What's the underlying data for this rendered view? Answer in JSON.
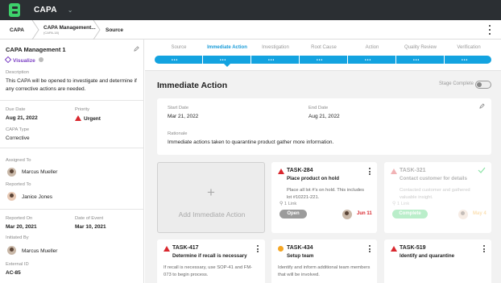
{
  "app": {
    "name": "CAPA"
  },
  "breadcrumbs": [
    {
      "label": "CAPA"
    },
    {
      "label": "CAPA Management...",
      "sub": "(CAPA-18)"
    },
    {
      "label": "Source"
    }
  ],
  "record": {
    "title": "CAPA Management 1",
    "visualize_label": "Visualize",
    "description_label": "Description",
    "description": "This CAPA will be opened to investigate and determine if any corrective actions are needed.",
    "due_date_label": "Due Date",
    "due_date": "Aug 21, 2022",
    "priority_label": "Priority",
    "priority": "Urgent",
    "capa_type_label": "CAPA Type",
    "capa_type": "Corrective",
    "assigned_to_label": "Assigned To",
    "assigned_to": "Marcus Mueller",
    "reported_to_label": "Reported To",
    "reported_to": "Janice Jones",
    "reported_on_label": "Reported On",
    "reported_on": "Mar 20, 2021",
    "date_of_event_label": "Date of Event",
    "date_of_event": "Mar 10, 2021",
    "initiated_by_label": "Initiated By",
    "initiated_by": "Marcus Mueller",
    "external_id_label": "External ID",
    "external_id": "AC-85"
  },
  "steps": [
    {
      "label": "Source",
      "active": false
    },
    {
      "label": "Immediate Action",
      "active": true
    },
    {
      "label": "Investigation",
      "active": false
    },
    {
      "label": "Root Cause",
      "active": false
    },
    {
      "label": "Action",
      "active": false
    },
    {
      "label": "Quality Review",
      "active": false
    },
    {
      "label": "Verification",
      "active": false
    }
  ],
  "section": {
    "title": "Immediate Action",
    "stage_complete_label": "Stage Complete",
    "start_date_label": "Start Date",
    "start_date": "Mar 21, 2022",
    "end_date_label": "End Date",
    "end_date": "Aug 21, 2022",
    "rationale_label": "Rationale",
    "rationale": "Immediate actions taken to quarantine product gather more information."
  },
  "add_card": {
    "label": "Add Immediate Action",
    "plus": "+"
  },
  "tasks": [
    {
      "id": "TASK-284",
      "name": "Place product on hold",
      "desc": "Place all lot #'s on hold. This includes lot #10221-221.",
      "link": "1 Link",
      "status": "Open",
      "status_color": "#9b9b9b",
      "date": "Jun 11",
      "faded": false,
      "icon": "warning-icon"
    },
    {
      "id": "TASK-321",
      "name": "Contact customer for details",
      "desc": "Contacted customer and gathered valuable insight.",
      "link": "1 Link",
      "status": "Complete",
      "status_color": "#3dd16b",
      "date": "May 4",
      "faded": true,
      "icon": "warning-icon"
    },
    {
      "id": "TASK-417",
      "name": "Determine if recall is necessary",
      "desc": "If recall is necessary, use SOP-41 and FM-073 to begin process.",
      "faded": false,
      "icon": "warning-icon"
    },
    {
      "id": "TASK-434",
      "name": "Setup team",
      "desc": "Identify and inform additional team members that will be involved.",
      "faded": false,
      "icon": "circle-icon"
    },
    {
      "id": "TASK-519",
      "name": "Identify and quarantine",
      "desc": "",
      "faded": false,
      "icon": "warning-icon"
    }
  ],
  "colors": {
    "accent": "#13a3e0",
    "urgent": "#d9272e",
    "brand": "#3dd16b"
  }
}
